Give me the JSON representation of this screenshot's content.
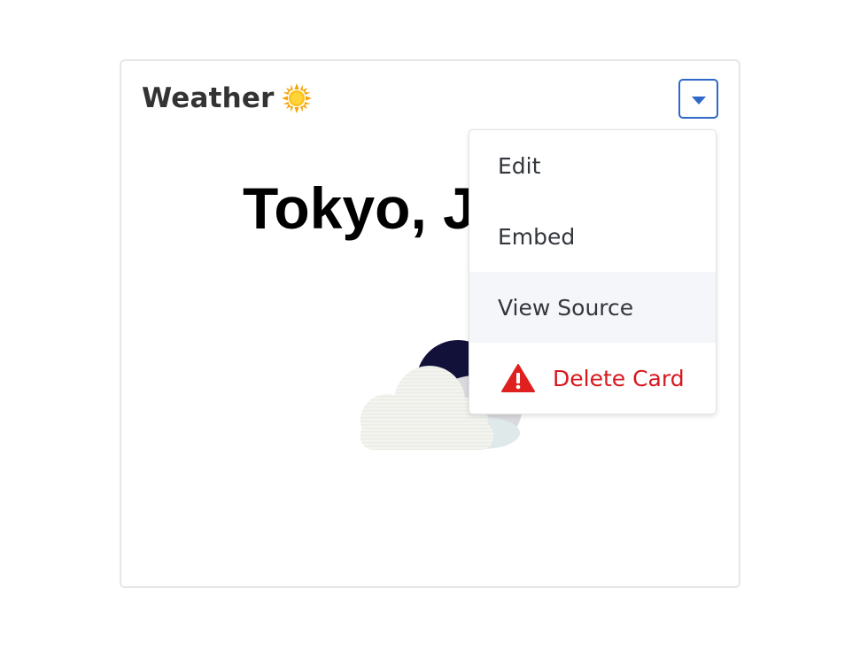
{
  "card": {
    "title": "Weather",
    "title_icon": "sun-emoji-icon",
    "city": "Tokyo, J",
    "weather_icon": "night-cloud-icon"
  },
  "menu": {
    "toggle_icon": "caret-down-icon",
    "items": [
      {
        "label": "Edit"
      },
      {
        "label": "Embed"
      },
      {
        "label": "View Source"
      },
      {
        "label": "Delete Card",
        "icon": "warning-icon"
      }
    ]
  },
  "colors": {
    "accent": "#2f68c9",
    "danger": "#d7191f",
    "hover_bg": "#f5f6f9"
  }
}
